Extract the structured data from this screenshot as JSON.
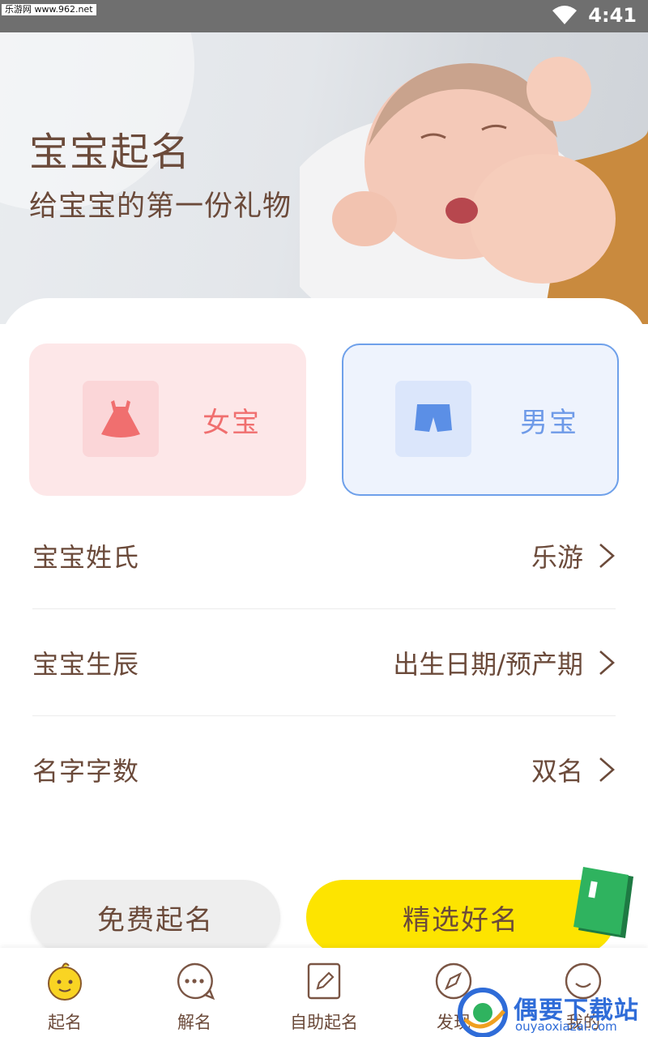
{
  "status_bar": {
    "watermark": "乐游网 www.962.net",
    "time": "4:41"
  },
  "hero": {
    "title": "宝宝起名",
    "subtitle": "给宝宝的第一份礼物"
  },
  "gender": {
    "girl_label": "女宝",
    "boy_label": "男宝",
    "girl_color": "#f06f6f",
    "boy_color": "#6e9ae8",
    "selected": "boy"
  },
  "settings": [
    {
      "label": "宝宝姓氏",
      "value": "乐游"
    },
    {
      "label": "宝宝生辰",
      "value": "出生日期/预产期"
    },
    {
      "label": "名字字数",
      "value": "双名"
    }
  ],
  "buttons": {
    "free": "免费起名",
    "pick": "精选好名",
    "pick_color": "#fde400"
  },
  "nav": [
    {
      "label": "起名",
      "icon": "baby-face-icon"
    },
    {
      "label": "解名",
      "icon": "chat-bubble-icon"
    },
    {
      "label": "自助起名",
      "icon": "edit-icon"
    },
    {
      "label": "发现",
      "icon": "compass-icon"
    },
    {
      "label": "我的",
      "icon": "smile-icon"
    }
  ],
  "watermark_bottom": {
    "main": "偶要下载站",
    "sub": "ouyaoxiazai.com"
  }
}
